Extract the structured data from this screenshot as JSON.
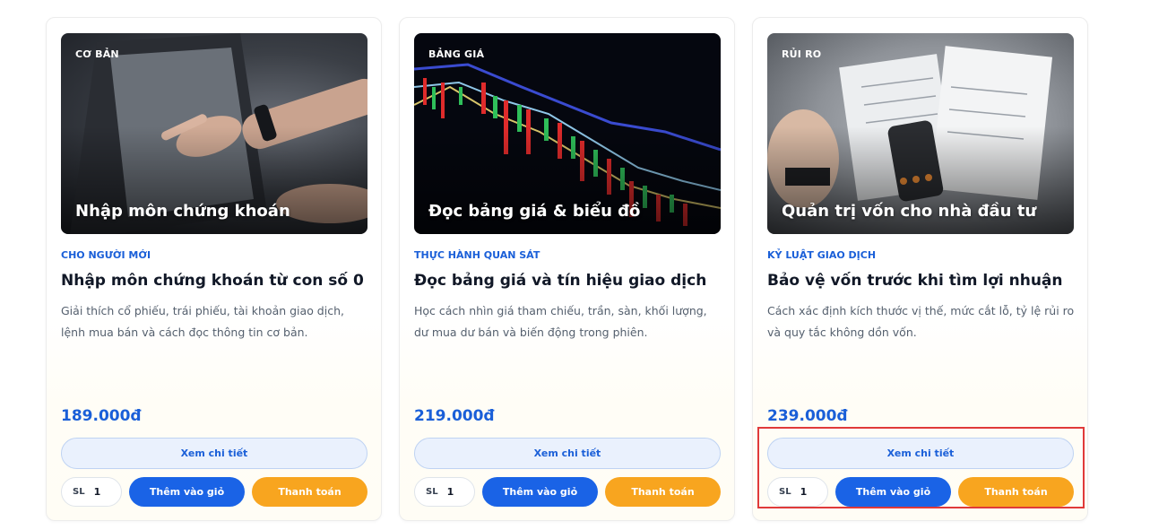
{
  "courses": [
    {
      "badge": "CƠ BẢN",
      "overlay_title": "Nhập môn chứng khoán",
      "category": "CHO NGƯỜI MỚI",
      "title": "Nhập môn chứng khoán từ con số 0",
      "description": "Giải thích cổ phiếu, trái phiếu, tài khoản giao dịch, lệnh mua bán và cách đọc thông tin cơ bản.",
      "price": "189.000đ",
      "detail_label": "Xem chi tiết",
      "qty_label": "SL",
      "qty_value": "1",
      "cart_label": "Thêm vào giỏ",
      "pay_label": "Thanh toán"
    },
    {
      "badge": "BẢNG GIÁ",
      "overlay_title": "Đọc bảng giá & biểu đồ",
      "category": "THỰC HÀNH QUAN SÁT",
      "title": "Đọc bảng giá và tín hiệu giao dịch",
      "description": "Học cách nhìn giá tham chiếu, trần, sàn, khối lượng, dư mua dư bán và biến động trong phiên.",
      "price": "219.000đ",
      "detail_label": "Xem chi tiết",
      "qty_label": "SL",
      "qty_value": "1",
      "cart_label": "Thêm vào giỏ",
      "pay_label": "Thanh toán"
    },
    {
      "badge": "RỦI RO",
      "overlay_title": "Quản trị vốn cho nhà đầu tư",
      "category": "KỶ LUẬT GIAO DỊCH",
      "title": "Bảo vệ vốn trước khi tìm lợi nhuận",
      "description": "Cách xác định kích thước vị thế, mức cắt lỗ, tỷ lệ rủi ro và quy tắc không dồn vốn.",
      "price": "239.000đ",
      "detail_label": "Xem chi tiết",
      "qty_label": "SL",
      "qty_value": "1",
      "cart_label": "Thêm vào giỏ",
      "pay_label": "Thanh toán"
    }
  ],
  "colors": {
    "accent": "#1a63e6",
    "pay": "#f8a51f",
    "highlight": "#e03a3a"
  }
}
